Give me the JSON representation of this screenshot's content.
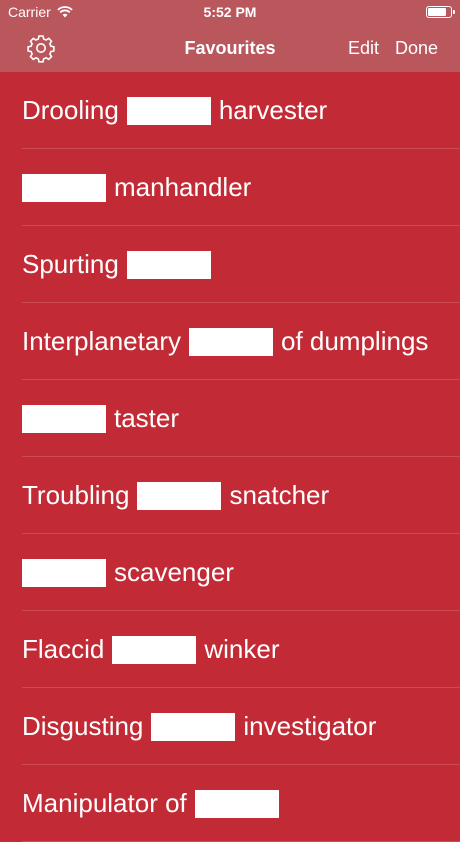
{
  "status_bar": {
    "carrier": "Carrier",
    "time": "5:52 PM"
  },
  "nav": {
    "title": "Favourites",
    "edit_label": "Edit",
    "done_label": "Done"
  },
  "colors": {
    "background": "#c22b36",
    "bar": "#b9575d"
  },
  "items": [
    {
      "before": "Drooling",
      "after": "harvester"
    },
    {
      "before": "",
      "after": "manhandler"
    },
    {
      "before": "Spurting",
      "after": ""
    },
    {
      "before": "Interplanetary",
      "after": "of dumplings"
    },
    {
      "before": "",
      "after": "taster"
    },
    {
      "before": "Troubling",
      "after": "snatcher"
    },
    {
      "before": "",
      "after": "scavenger"
    },
    {
      "before": "Flaccid",
      "after": "winker"
    },
    {
      "before": "Disgusting",
      "after": "investigator"
    },
    {
      "before": "Manipulator of",
      "after": ""
    }
  ]
}
